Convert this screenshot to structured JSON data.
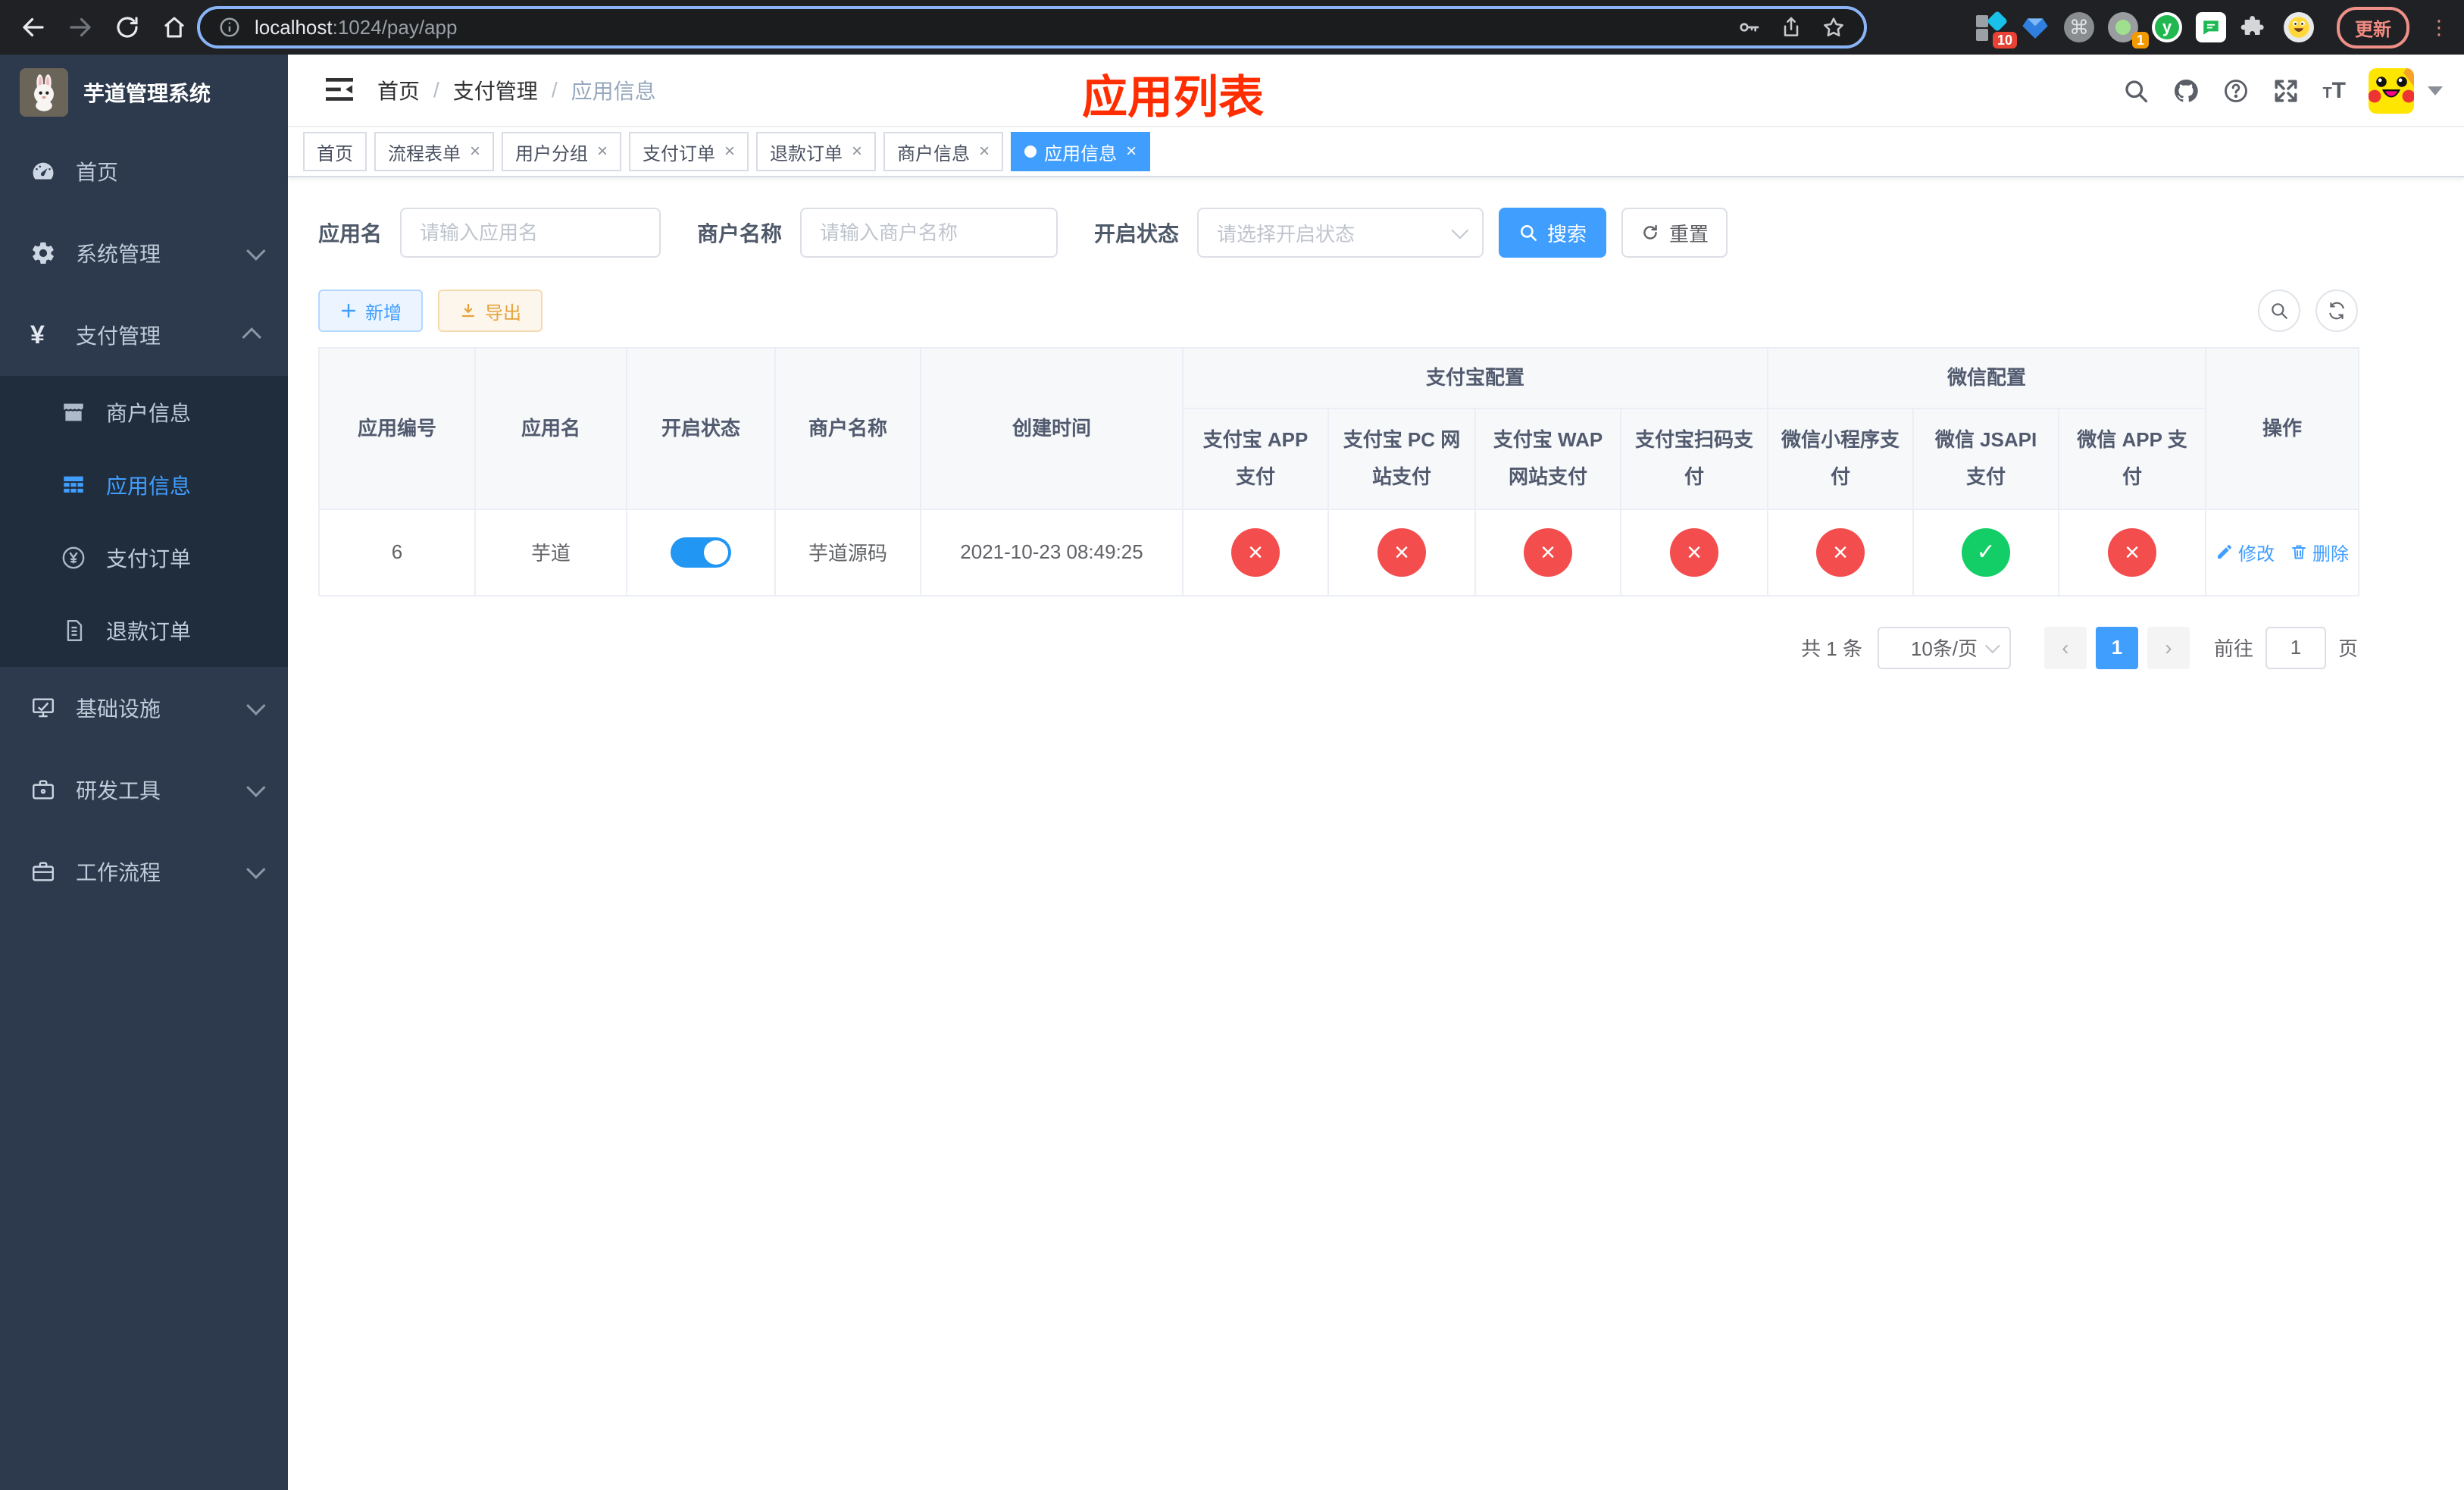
{
  "browser": {
    "url_host": "localhost",
    "url_rest": ":1024/pay/app",
    "update_label": "更新",
    "ext_badge_a": "10",
    "ext_badge_b": "1"
  },
  "sidebar": {
    "title": "芋道管理系统",
    "items": [
      {
        "label": "首页"
      },
      {
        "label": "系统管理"
      },
      {
        "label": "支付管理"
      },
      {
        "label": "基础设施"
      },
      {
        "label": "研发工具"
      },
      {
        "label": "工作流程"
      }
    ],
    "payment_children": [
      {
        "label": "商户信息"
      },
      {
        "label": "应用信息"
      },
      {
        "label": "支付订单"
      },
      {
        "label": "退款订单"
      }
    ]
  },
  "navbar": {
    "breadcrumb": [
      "首页",
      "支付管理",
      "应用信息"
    ],
    "page_title": "应用列表"
  },
  "tabs": [
    {
      "label": "首页",
      "closable": false,
      "active": false
    },
    {
      "label": "流程表单",
      "closable": true,
      "active": false
    },
    {
      "label": "用户分组",
      "closable": true,
      "active": false
    },
    {
      "label": "支付订单",
      "closable": true,
      "active": false
    },
    {
      "label": "退款订单",
      "closable": true,
      "active": false
    },
    {
      "label": "商户信息",
      "closable": true,
      "active": false
    },
    {
      "label": "应用信息",
      "closable": true,
      "active": true
    }
  ],
  "filters": {
    "app_name_label": "应用名",
    "app_name_placeholder": "请输入应用名",
    "merchant_label": "商户名称",
    "merchant_placeholder": "请输入商户名称",
    "status_label": "开启状态",
    "status_placeholder": "请选择开启状态",
    "search_label": "搜索",
    "reset_label": "重置"
  },
  "toolbar": {
    "add_label": "新增",
    "export_label": "导出"
  },
  "table": {
    "columns": [
      "应用编号",
      "应用名",
      "开启状态",
      "商户名称",
      "创建时间"
    ],
    "groups": [
      "支付宝配置",
      "微信配置"
    ],
    "subcolumns": [
      "支付宝 APP 支付",
      "支付宝 PC 网站支付",
      "支付宝 WAP 网站支付",
      "支付宝扫码支付",
      "微信小程序支付",
      "微信 JSAPI 支付",
      "微信 APP 支付"
    ],
    "op_column": "操作",
    "row": {
      "id": "6",
      "name": "芋道",
      "enabled": true,
      "merchant": "芋道源码",
      "created_at": "2021-10-23 08:49:25",
      "statuses": [
        false,
        false,
        false,
        false,
        false,
        true,
        false
      ]
    },
    "actions": {
      "edit": "修改",
      "delete": "删除"
    }
  },
  "pagination": {
    "total": "共 1 条",
    "page_size": "10条/页",
    "page": "1",
    "goto_label": "前往",
    "goto_value": "1",
    "unit": "页"
  },
  "colors": {
    "accent": "#409eff",
    "danger": "#f34d4d",
    "success": "#13ce66",
    "warning": "#e6a23c",
    "title_red": "#ff2d00"
  }
}
